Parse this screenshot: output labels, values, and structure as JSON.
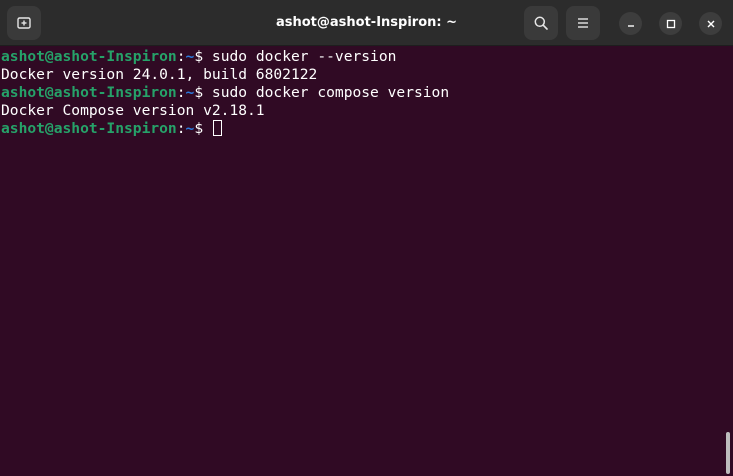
{
  "window": {
    "title": "ashot@ashot-Inspiron: ~"
  },
  "header": {
    "left_buttons": [
      {
        "name": "new-tab",
        "icon": "new-tab-icon"
      }
    ],
    "right_buttons": [
      {
        "name": "search",
        "icon": "search-icon"
      },
      {
        "name": "menu",
        "icon": "hamburger-menu-icon"
      }
    ],
    "window_controls": [
      {
        "name": "minimize",
        "icon": "minimize-icon"
      },
      {
        "name": "maximize",
        "icon": "maximize-icon"
      },
      {
        "name": "close",
        "icon": "close-icon"
      }
    ]
  },
  "terminal": {
    "prompt_user": "ashot@ashot-Inspiron",
    "prompt_sep": ":",
    "prompt_path": "~",
    "prompt_symbol": "$ ",
    "lines": [
      {
        "type": "prompt",
        "command": "sudo docker --version"
      },
      {
        "type": "output",
        "text": "Docker version 24.0.1, build 6802122"
      },
      {
        "type": "prompt",
        "command": "sudo docker compose version"
      },
      {
        "type": "output",
        "text": "Docker Compose version v2.18.1"
      },
      {
        "type": "prompt",
        "command": ""
      }
    ]
  },
  "colors": {
    "background": "#300a24",
    "header": "#2c2c2c",
    "prompt_user": "#26a269",
    "prompt_path": "#2a7bde",
    "text": "#ffffff"
  }
}
